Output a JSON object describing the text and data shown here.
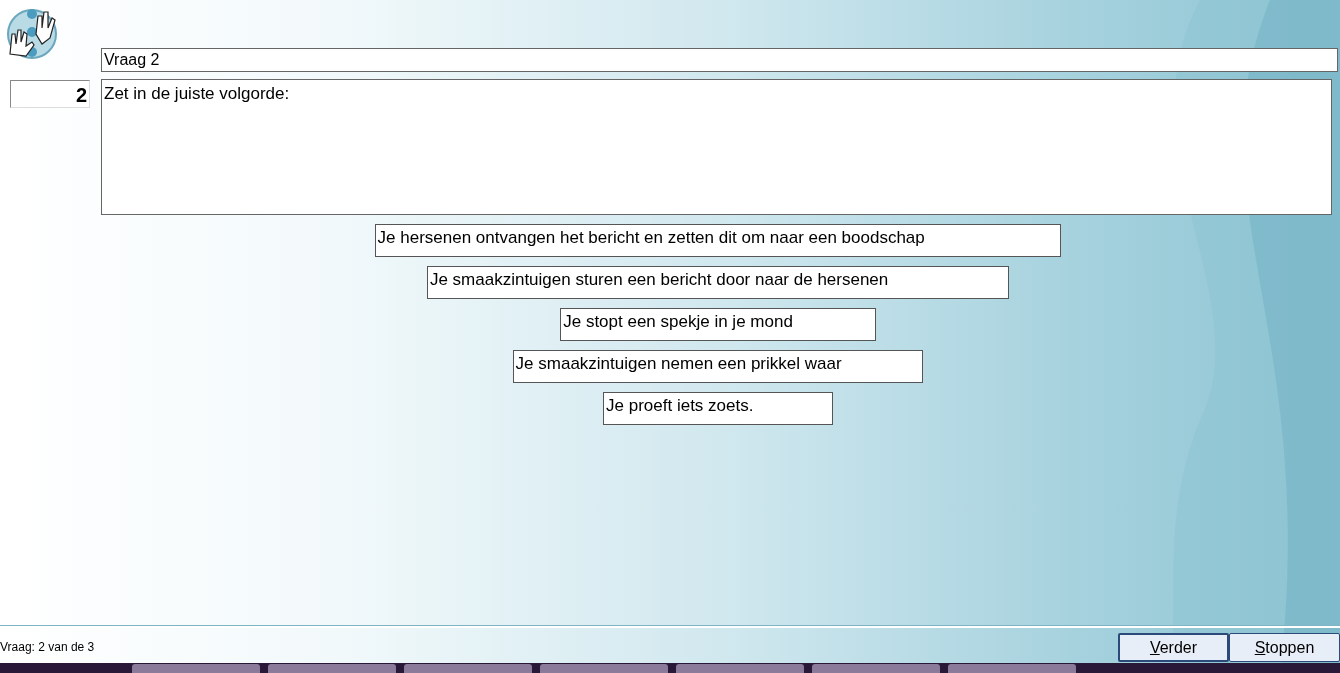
{
  "title_field": {
    "value": "Vraag 2"
  },
  "question_number": "2",
  "question_text": "Zet in de juiste volgorde:",
  "items": [
    {
      "label": "Je hersenen ontvangen het bericht en zetten dit om naar een boodschap"
    },
    {
      "label": "Je smaakzintuigen sturen een bericht door naar de hersenen"
    },
    {
      "label": "Je stopt een spekje in je mond"
    },
    {
      "label": "Je smaakzintuigen nemen een prikkel waar"
    },
    {
      "label": "Je proeft iets zoets."
    }
  ],
  "status": "Vraag: 2 van de 3",
  "buttons": [
    "Verder",
    "Stoppen"
  ]
}
